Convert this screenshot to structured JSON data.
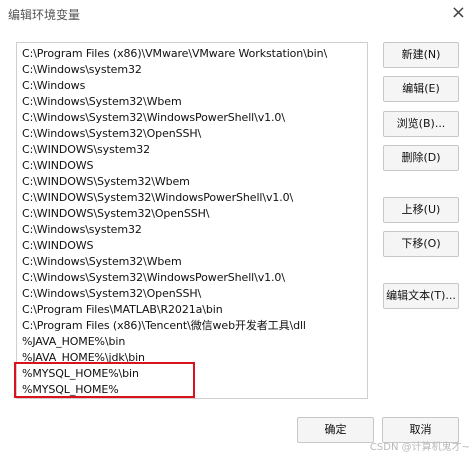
{
  "window": {
    "title": "编辑环境变量",
    "close_glyph": "×"
  },
  "path_list": {
    "items": [
      "C:\\Program Files (x86)\\VMware\\VMware Workstation\\bin\\",
      "C:\\Windows\\system32",
      "C:\\Windows",
      "C:\\Windows\\System32\\Wbem",
      "C:\\Windows\\System32\\WindowsPowerShell\\v1.0\\",
      "C:\\Windows\\System32\\OpenSSH\\",
      "C:\\WINDOWS\\system32",
      "C:\\WINDOWS",
      "C:\\WINDOWS\\System32\\Wbem",
      "C:\\WINDOWS\\System32\\WindowsPowerShell\\v1.0\\",
      "C:\\WINDOWS\\System32\\OpenSSH\\",
      "C:\\Windows\\system32",
      "C:\\WINDOWS",
      "C:\\Windows\\System32\\Wbem",
      "C:\\Windows\\System32\\WindowsPowerShell\\v1.0\\",
      "C:\\Windows\\System32\\OpenSSH\\",
      "C:\\Program Files\\MATLAB\\R2021a\\bin",
      "C:\\Program Files (x86)\\Tencent\\微信web开发者工具\\dll",
      "%JAVA_HOME%\\bin",
      "%JAVA_HOME%\\jdk\\bin",
      "%MYSQL_HOME%\\bin",
      "%MYSQL_HOME%"
    ]
  },
  "side_buttons": {
    "new": "新建(N)",
    "edit": "编辑(E)",
    "browse": "浏览(B)...",
    "delete": "删除(D)",
    "move_up": "上移(U)",
    "move_down": "下移(O)",
    "edit_text": "编辑文本(T)..."
  },
  "bottom_buttons": {
    "ok": "确定",
    "cancel": "取消"
  },
  "watermark": "CSDN @计算机鬼才~",
  "colors": {
    "highlight_border": "#d9121f"
  }
}
